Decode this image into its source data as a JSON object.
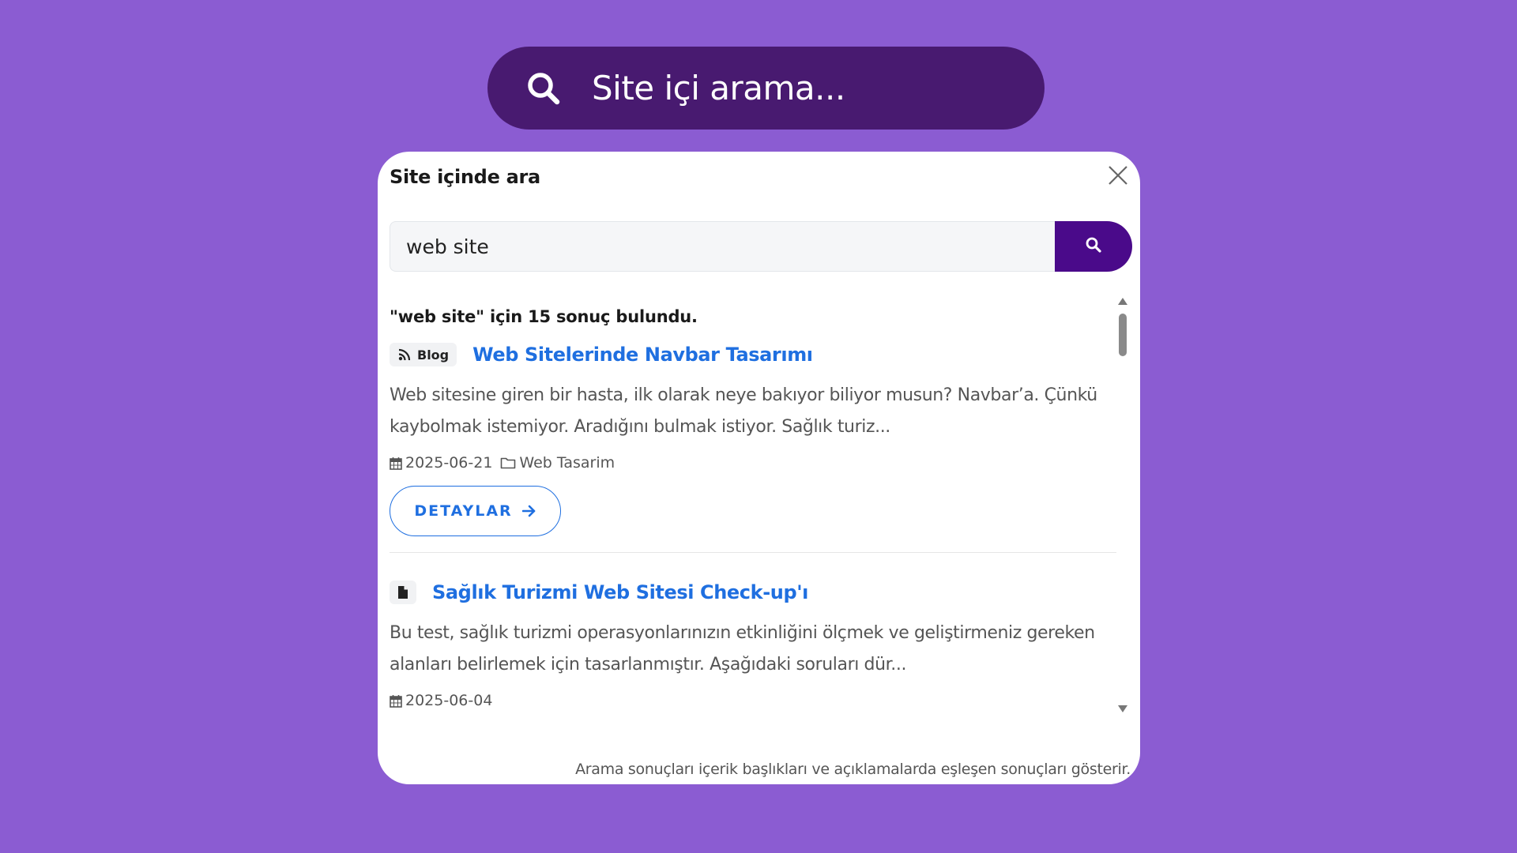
{
  "hero_search": {
    "label": "Site içi arama...",
    "icon": "search-icon"
  },
  "modal": {
    "title": "Site içinde ara",
    "close_icon": "close-icon",
    "search": {
      "value": "web site",
      "submit_icon": "search-icon"
    },
    "results_count": "\"web site\" için 15 sonuç bulundu.",
    "results": [
      {
        "type_label": "Blog",
        "type_icon": "rss-icon",
        "title": "Web Sitelerinde Navbar Tasarımı",
        "excerpt": "Web sitesine giren bir hasta, ilk olarak neye bakıyor biliyor musun? Navbar’a. Çünkü kaybolmak istemiyor. Aradığını bulmak istiyor. Sağlık turiz...",
        "date": "2025-06-21",
        "category": "Web Tasarim",
        "details_label": "DETAYLAR"
      },
      {
        "type_label": "",
        "type_icon": "document-icon",
        "title": "Sağlık Turizmi Web Sitesi Check-up'ı",
        "excerpt": "Bu test, sağlık turizmi operasyonlarınızın etkinliğini ölçmek ve geliştirmeniz gereken alanları belirlemek için tasarlanmıştır. Aşağıdaki soruları dür...",
        "date": "2025-06-04"
      }
    ],
    "footer_note": "Arama sonuçları içerik başlıkları ve açıklamalarda eşleşen sonuçları gösterir."
  },
  "colors": {
    "background": "#8b5cd2",
    "hero_pill": "#481a70",
    "submit_button": "#4a0a8a",
    "link_blue": "#1f6fe0"
  }
}
